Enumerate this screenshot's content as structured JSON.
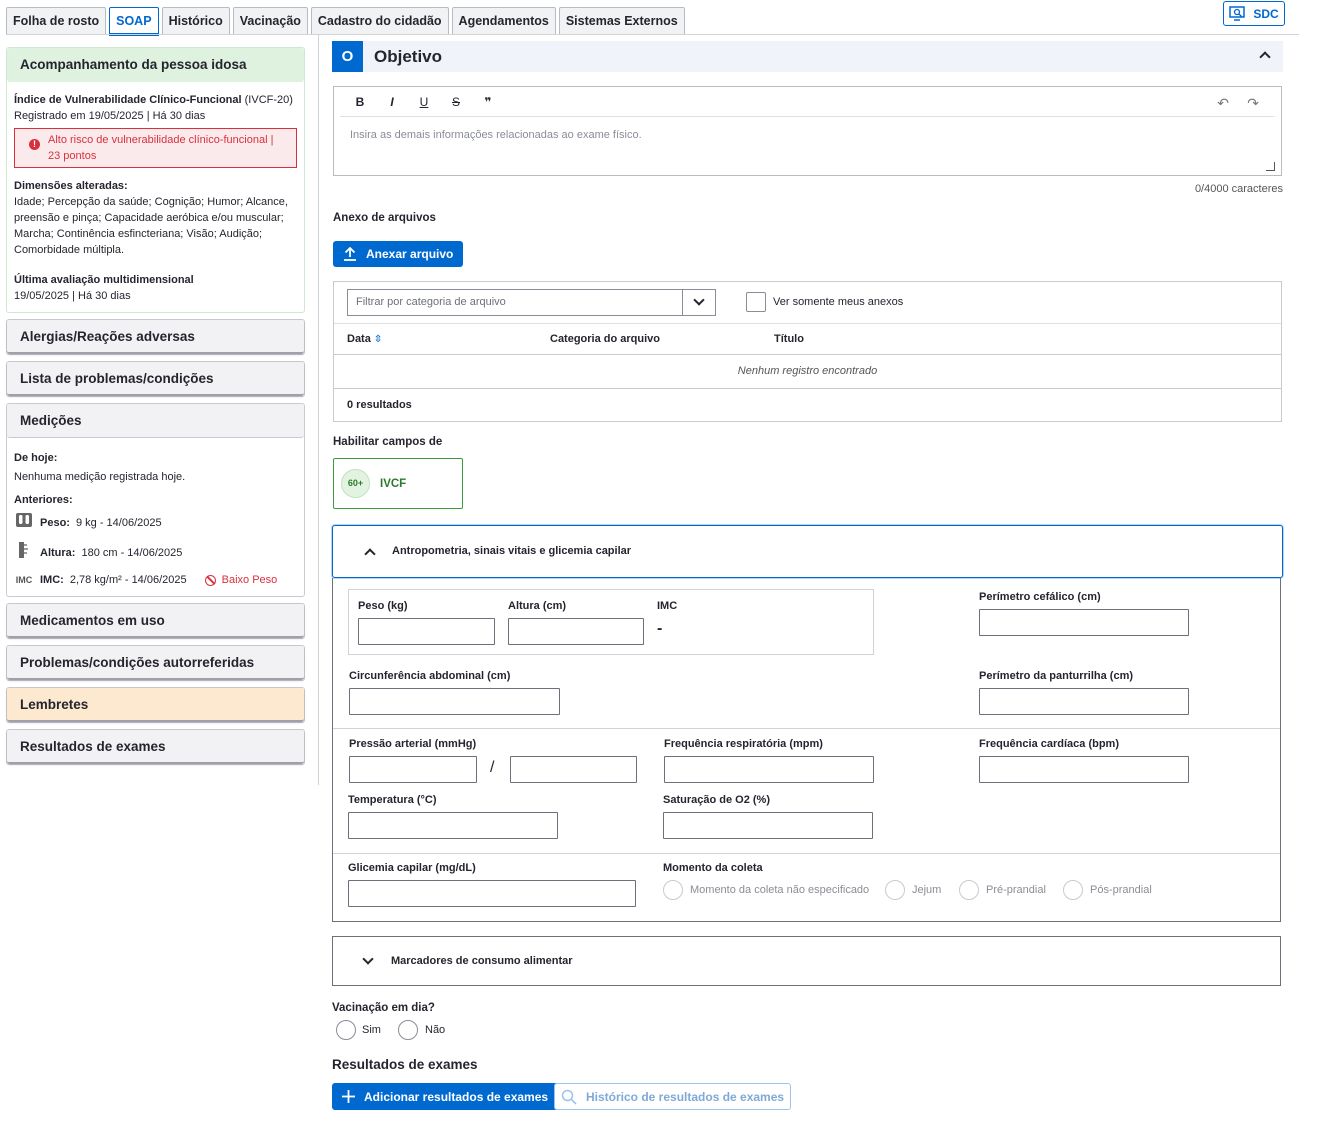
{
  "tabs": [
    "Folha de rosto",
    "SOAP",
    "Histórico",
    "Vacinação",
    "Cadastro do cidadão",
    "Agendamentos",
    "Sistemas Externos"
  ],
  "sdc_label": "SDC",
  "sidebar": {
    "idoso": {
      "title": "Acompanhamento da pessoa idosa",
      "ivcf_name": "Índice de Vulnerabilidade Clínico-Funcional",
      "ivcf_code": "(IVCF-20)",
      "registered": "Registrado em 19/05/2025 | Há 30 dias",
      "alert": "Alto risco de vulnerabilidade clínico-funcional | 23 pontos",
      "dims_title": "Dimensões alteradas:",
      "dims_text": "Idade; Percepção da saúde; Cognição; Humor; Alcance, preensão e pinça; Capacidade aeróbica e/ou muscular; Marcha; Continência esfincteriana; Visão; Audição; Comorbidade múltipla.",
      "last_eval_title": "Última avaliação multidimensional",
      "last_eval_date": "19/05/2025 | Há 30 dias"
    },
    "alergias": "Alergias/Reações adversas",
    "problemas": "Lista de problemas/condições",
    "medicoes": {
      "title": "Medições",
      "today_title": "De hoje:",
      "today_text": "Nenhuma medição registrada hoje.",
      "prev_title": "Anteriores:",
      "peso_label": "Peso:",
      "peso_value": "9 kg - 14/06/2025",
      "altura_label": "Altura:",
      "altura_value": "180 cm - 14/06/2025",
      "imc_icon": "IMC",
      "imc_label": "IMC:",
      "imc_value": "2,78 kg/m² - 14/06/2025",
      "imc_status": "Baixo Peso"
    },
    "medicamentos": "Medicamentos em uso",
    "autorreferidas": "Problemas/condições autorreferidas",
    "lembretes": "Lembretes",
    "resultados": "Resultados de exames"
  },
  "objetivo": {
    "badge": "O",
    "title": "Objetivo",
    "toolbar": {
      "bold": "B",
      "italic": "I",
      "underline": "U",
      "strike": "S",
      "quote": "❞",
      "undo": "↶",
      "redo": "↷"
    },
    "placeholder": "Insira as demais informações relacionadas ao exame físico.",
    "counter": "0/4000 caracteres"
  },
  "anexo": {
    "title": "Anexo de arquivos",
    "button": "Anexar arquivo",
    "filter_placeholder": "Filtrar por categoria de arquivo",
    "only_mine": "Ver somente meus anexos",
    "columns": [
      "Data",
      "Categoria do arquivo",
      "Título"
    ],
    "empty": "Nenhum registro encontrado",
    "results": "0 resultados"
  },
  "habilitar": {
    "title": "Habilitar campos de",
    "badge": "60+",
    "label": "IVCF"
  },
  "antropometria": {
    "title": "Antropometria, sinais vitais e glicemia capilar",
    "peso": "Peso (kg)",
    "altura": "Altura (cm)",
    "imc": "IMC",
    "imc_value": "-",
    "perimetro_cefalico": "Perímetro cefálico (cm)",
    "circ_abdominal": "Circunferência abdominal (cm)",
    "perimetro_panturrilha": "Perímetro da panturrilha (cm)",
    "pressao": "Pressão arterial (mmHg)",
    "pressao_sep": "/",
    "freq_resp": "Frequência respiratória (mpm)",
    "freq_card": "Frequência cardíaca (bpm)",
    "temperatura": "Temperatura (°C)",
    "saturacao": "Saturação de O2 (%)",
    "glicemia": "Glicemia capilar (mg/dL)",
    "momento": "Momento da coleta",
    "momento_options": [
      "Momento da coleta não especificado",
      "Jejum",
      "Pré-prandial",
      "Pós-prandial"
    ]
  },
  "marcadores": {
    "title": "Marcadores de consumo alimentar"
  },
  "vacinacao": {
    "title": "Vacinação em dia?",
    "sim": "Sim",
    "nao": "Não"
  },
  "exames": {
    "title": "Resultados de exames",
    "add": "Adicionar resultados de exames",
    "historico": "Histórico de resultados de exames"
  },
  "colors": {
    "primary": "#0069d0",
    "danger": "#d9303d",
    "success": "#2b7a2b"
  }
}
